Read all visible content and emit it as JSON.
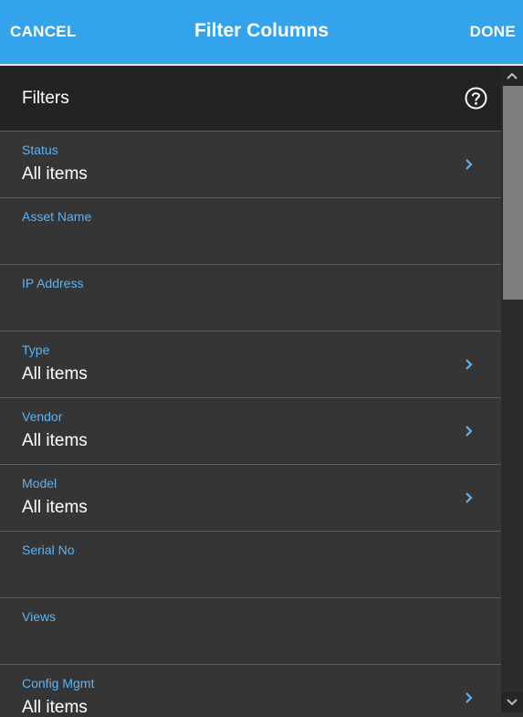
{
  "header": {
    "cancel_label": "CANCEL",
    "title": "Filter Columns",
    "done_label": "DONE"
  },
  "section": {
    "title": "Filters",
    "help_icon": "help-circle-icon"
  },
  "filters": [
    {
      "label": "Status",
      "value": "All items",
      "has_chevron": true
    },
    {
      "label": "Asset Name",
      "value": "",
      "has_chevron": false
    },
    {
      "label": "IP Address",
      "value": "",
      "has_chevron": false
    },
    {
      "label": "Type",
      "value": "All items",
      "has_chevron": true
    },
    {
      "label": "Vendor",
      "value": "All items",
      "has_chevron": true
    },
    {
      "label": "Model",
      "value": "All items",
      "has_chevron": true
    },
    {
      "label": "Serial No",
      "value": "",
      "has_chevron": false
    },
    {
      "label": "Views",
      "value": "",
      "has_chevron": false
    },
    {
      "label": "Config Mgmt",
      "value": "All items",
      "has_chevron": true
    }
  ],
  "colors": {
    "header_bg": "#33a3ec",
    "label_blue": "#5cb3f3",
    "row_bg": "#353535",
    "section_bg": "#232323"
  }
}
